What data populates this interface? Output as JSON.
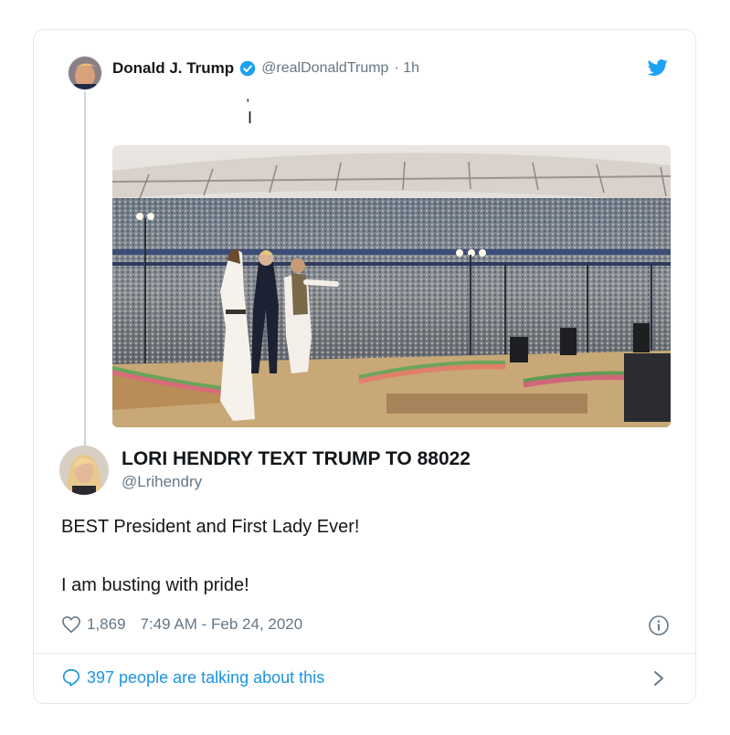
{
  "tweet": {
    "author_name": "Donald J. Trump",
    "author_handle": "@realDonaldTrump",
    "time_ago": "· 1h",
    "text_mark_1": ",",
    "text_mark_2": "I",
    "media_icon": "photo-stadium"
  },
  "quoted": {
    "author_name": "LORI HENDRY TEXT TRUMP TO 88022",
    "author_handle": "@Lrihendry",
    "text_line_1": "BEST President and First Lady Ever!",
    "text_line_2": "I am busting with pride!",
    "likes": "1,869",
    "timestamp": "7:49 AM - Feb 24, 2020"
  },
  "footer": {
    "talking_label": "397 people are talking about this"
  },
  "colors": {
    "brand_blue": "#1da1f2",
    "link_blue": "#1b95e0",
    "muted": "#657786",
    "border": "#e1e8ed"
  }
}
